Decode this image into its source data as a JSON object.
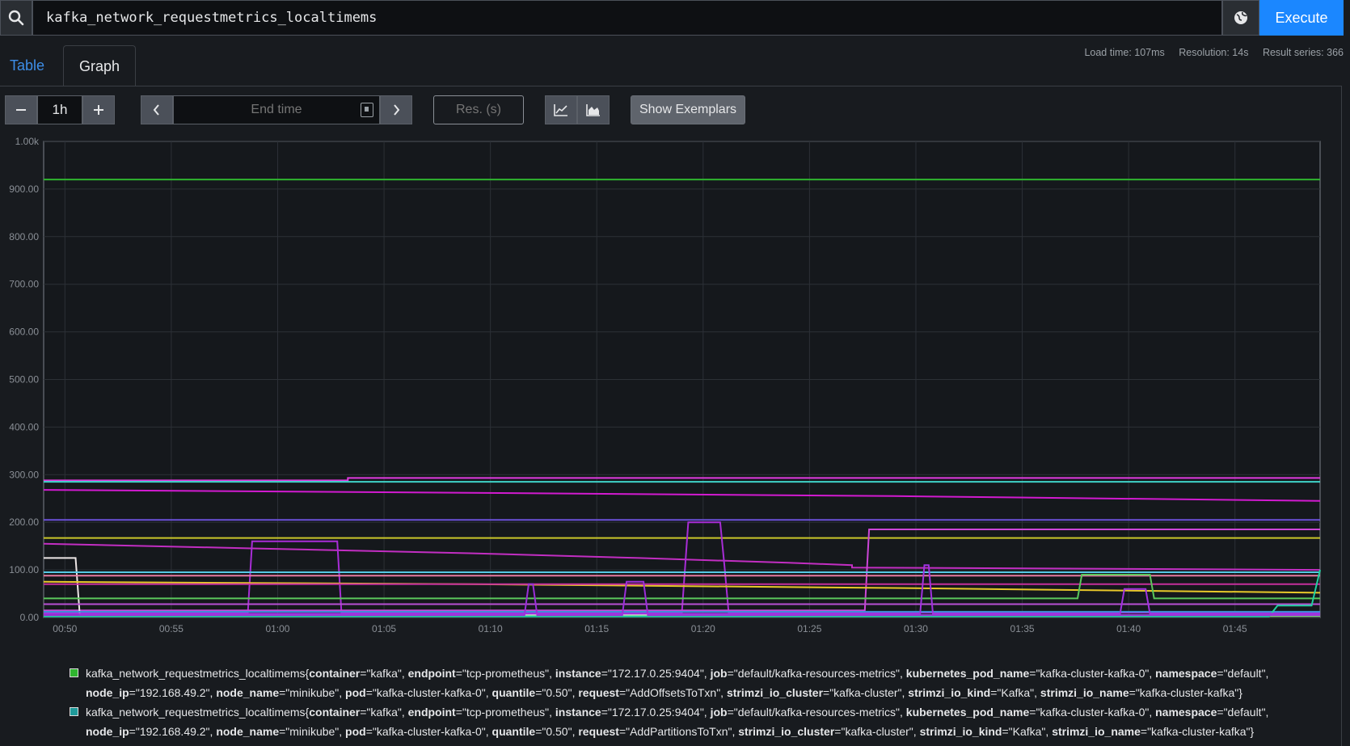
{
  "query": {
    "value": "kafka_network_requestmetrics_localtimems"
  },
  "execute_label": "Execute",
  "tabs": {
    "table": "Table",
    "graph": "Graph"
  },
  "stats": {
    "load_time": "Load time: 107ms",
    "resolution": "Resolution: 14s",
    "result_series": "Result series: 366"
  },
  "controls": {
    "range": "1h",
    "end_time_placeholder": "End time",
    "res_placeholder": "Res. (s)",
    "show_exemplars": "Show Exemplars"
  },
  "colors": {
    "accent": "#1b87ff",
    "tab_link": "#3d8ee8",
    "background": "#181b1f"
  },
  "chart_data": {
    "type": "line",
    "ylim": [
      0,
      1000
    ],
    "y_tick_labels": [
      "0.00",
      "100.00",
      "200.00",
      "300.00",
      "400.00",
      "500.00",
      "600.00",
      "700.00",
      "800.00",
      "900.00",
      "1.00k"
    ],
    "y_ticks": [
      0,
      100,
      200,
      300,
      400,
      500,
      600,
      700,
      800,
      900,
      1000
    ],
    "x_tick_labels": [
      "00:50",
      "00:55",
      "01:00",
      "01:05",
      "01:10",
      "01:15",
      "01:20",
      "01:25",
      "01:30",
      "01:35",
      "01:40",
      "01:45"
    ],
    "x_ticks": [
      1,
      6,
      11,
      16,
      21,
      26,
      31,
      36,
      41,
      46,
      51,
      56
    ],
    "xlim": [
      0,
      60
    ],
    "grid": true,
    "series": [
      {
        "color": "#2fb52f",
        "points": [
          [
            0,
            920
          ],
          [
            60,
            920
          ]
        ]
      },
      {
        "color": "#e03adf",
        "points": [
          [
            0,
            288
          ],
          [
            14.3,
            288
          ],
          [
            14.3,
            293
          ],
          [
            60,
            293
          ]
        ]
      },
      {
        "color": "#3fd4c8",
        "points": [
          [
            0,
            285
          ],
          [
            60,
            285
          ]
        ]
      },
      {
        "color": "#d21ad0",
        "points": [
          [
            0,
            268
          ],
          [
            20,
            262
          ],
          [
            40,
            255
          ],
          [
            60,
            245
          ]
        ]
      },
      {
        "color": "#6b50d8",
        "points": [
          [
            0,
            205
          ],
          [
            60,
            205
          ]
        ]
      },
      {
        "color": "#c9c62a",
        "points": [
          [
            0,
            167
          ],
          [
            60,
            167
          ]
        ]
      },
      {
        "color": "#c22ec2",
        "points": [
          [
            0,
            155
          ],
          [
            10,
            145
          ],
          [
            20,
            135
          ],
          [
            28,
            125
          ],
          [
            35,
            115
          ],
          [
            38,
            110
          ],
          [
            38,
            105
          ],
          [
            60,
            100
          ]
        ]
      },
      {
        "color": "#a82dd6",
        "points": [
          [
            0,
            10
          ],
          [
            9.6,
            10
          ],
          [
            9.8,
            160
          ],
          [
            13.8,
            160
          ],
          [
            14,
            10
          ],
          [
            30,
            10
          ],
          [
            30.3,
            200
          ],
          [
            31.8,
            200
          ],
          [
            32,
            110
          ],
          [
            32.2,
            10
          ],
          [
            60,
            10
          ]
        ]
      },
      {
        "color": "#cd46d8",
        "points": [
          [
            0,
            15
          ],
          [
            38.6,
            15
          ],
          [
            38.8,
            185
          ],
          [
            60,
            185
          ]
        ]
      },
      {
        "color": "#ede6e6",
        "points": [
          [
            0,
            125
          ],
          [
            1.5,
            125
          ],
          [
            1.7,
            5
          ],
          [
            60,
            5
          ]
        ]
      },
      {
        "color": "#e8c82a",
        "points": [
          [
            0,
            75
          ],
          [
            20,
            70
          ],
          [
            40,
            62
          ],
          [
            60,
            52
          ]
        ]
      },
      {
        "color": "#56c9e6",
        "points": [
          [
            0,
            95
          ],
          [
            60,
            95
          ]
        ]
      },
      {
        "color": "#e77aa1",
        "points": [
          [
            0,
            88
          ],
          [
            60,
            88
          ]
        ]
      },
      {
        "color": "#c52f9c",
        "points": [
          [
            0,
            70
          ],
          [
            60,
            70
          ]
        ]
      },
      {
        "color": "#5bc85b",
        "points": [
          [
            0,
            40
          ],
          [
            48.6,
            40
          ],
          [
            48.8,
            90
          ],
          [
            52,
            90
          ],
          [
            52.2,
            40
          ],
          [
            60,
            40
          ]
        ]
      },
      {
        "color": "#b84fd4",
        "points": [
          [
            0,
            28
          ],
          [
            60,
            28
          ]
        ]
      },
      {
        "color": "#3a8ed8",
        "points": [
          [
            0,
            12
          ],
          [
            60,
            12
          ]
        ]
      },
      {
        "color": "#7fe07f",
        "points": [
          [
            0,
            3
          ],
          [
            60,
            3
          ]
        ]
      },
      {
        "color": "#20d0a0",
        "points": [
          [
            0,
            2
          ],
          [
            57.6,
            2
          ],
          [
            58,
            25
          ],
          [
            59.6,
            25
          ],
          [
            60,
            100
          ]
        ]
      },
      {
        "color": "#9a2fd8",
        "points": [
          [
            0,
            5
          ],
          [
            22.6,
            5
          ],
          [
            22.8,
            70
          ],
          [
            23,
            70
          ],
          [
            23.2,
            5
          ],
          [
            27.2,
            5
          ],
          [
            27.4,
            75
          ],
          [
            28.2,
            75
          ],
          [
            28.4,
            5
          ],
          [
            60,
            5
          ]
        ]
      },
      {
        "color": "#a033e0",
        "points": [
          [
            0,
            8
          ],
          [
            41.2,
            8
          ],
          [
            41.4,
            110
          ],
          [
            41.6,
            110
          ],
          [
            41.8,
            8
          ],
          [
            50.6,
            8
          ],
          [
            50.8,
            60
          ],
          [
            51.8,
            60
          ],
          [
            52,
            8
          ],
          [
            60,
            8
          ]
        ]
      }
    ]
  },
  "legend": [
    {
      "color": "#2fb52f",
      "metric": "kafka_network_requestmetrics_localtimems",
      "labels": [
        {
          "k": "container",
          "v": "\"kafka\""
        },
        {
          "k": "endpoint",
          "v": "\"tcp-prometheus\""
        },
        {
          "k": "instance",
          "v": "\"172.17.0.25:9404\""
        },
        {
          "k": "job",
          "v": "\"default/kafka-resources-metrics\""
        },
        {
          "k": "kubernetes_pod_name",
          "v": "\"kafka-cluster-kafka-0\""
        },
        {
          "k": "namespace",
          "v": "\"default\""
        },
        {
          "k": "node_ip",
          "v": "\"192.168.49.2\""
        },
        {
          "k": "node_name",
          "v": "\"minikube\""
        },
        {
          "k": "pod",
          "v": "\"kafka-cluster-kafka-0\""
        },
        {
          "k": "quantile",
          "v": "\"0.50\""
        },
        {
          "k": "request",
          "v": "\"AddOffsetsToTxn\""
        },
        {
          "k": "strimzi_io_cluster",
          "v": "\"kafka-cluster\""
        },
        {
          "k": "strimzi_io_kind",
          "v": "\"Kafka\""
        },
        {
          "k": "strimzi_io_name",
          "v": "\"kafka-cluster-kafka\""
        }
      ]
    },
    {
      "color": "#1f9a9a",
      "metric": "kafka_network_requestmetrics_localtimems",
      "labels": [
        {
          "k": "container",
          "v": "\"kafka\""
        },
        {
          "k": "endpoint",
          "v": "\"tcp-prometheus\""
        },
        {
          "k": "instance",
          "v": "\"172.17.0.25:9404\""
        },
        {
          "k": "job",
          "v": "\"default/kafka-resources-metrics\""
        },
        {
          "k": "kubernetes_pod_name",
          "v": "\"kafka-cluster-kafka-0\""
        },
        {
          "k": "namespace",
          "v": "\"default\""
        },
        {
          "k": "node_ip",
          "v": "\"192.168.49.2\""
        },
        {
          "k": "node_name",
          "v": "\"minikube\""
        },
        {
          "k": "pod",
          "v": "\"kafka-cluster-kafka-0\""
        },
        {
          "k": "quantile",
          "v": "\"0.50\""
        },
        {
          "k": "request",
          "v": "\"AddPartitionsToTxn\""
        },
        {
          "k": "strimzi_io_cluster",
          "v": "\"kafka-cluster\""
        },
        {
          "k": "strimzi_io_kind",
          "v": "\"Kafka\""
        },
        {
          "k": "strimzi_io_name",
          "v": "\"kafka-cluster-kafka\""
        }
      ]
    }
  ]
}
